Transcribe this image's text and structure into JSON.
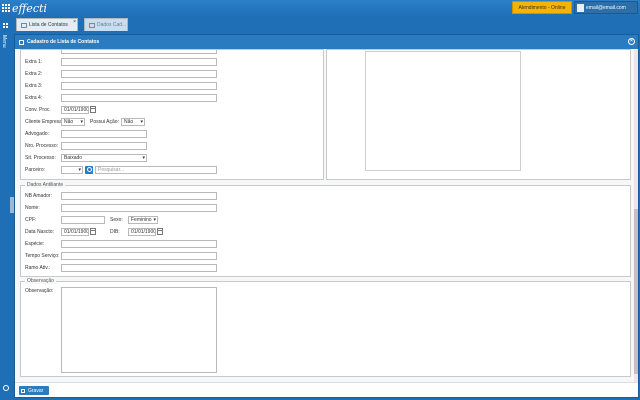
{
  "app": {
    "logo_text": "effecti"
  },
  "header": {
    "attendance_label": "Atendimento - Online",
    "user_email": "email@email.com"
  },
  "sidebar": {
    "menu_label": "Menu"
  },
  "tabs": [
    {
      "label": "Lista de Contatos"
    },
    {
      "label": "Dados Cad..."
    }
  ],
  "window": {
    "title": "Cadastro de Lista de Contatos"
  },
  "form": {
    "extra1_label": "Extra 1:",
    "extra2_label": "Extra 2:",
    "extra3_label": "Extra 3:",
    "extra4_label": "Extra 4:",
    "conv_proc_label": "Conv. Proc.",
    "conv_proc_value": "01/01/1900",
    "cliente_empresa_label": "Cliente Empresa:",
    "cliente_empresa_value": "Não",
    "possui_acao_label": "Possui Ação:",
    "possui_acao_value": "Não",
    "advogado_label": "Advogado:",
    "nro_processo_label": "Nro. Processo:",
    "sit_processo_label": "Sit. Processo:",
    "sit_processo_value": "Baixado",
    "parceiro_label": "Parceiro:",
    "parceiro_placeholder": "Pesquisar..."
  },
  "dados_antiliante": {
    "legend": "Dados Antiliante",
    "nb_amador_label": "NB Amador:",
    "nome_label": "Nome:",
    "cpf_label": "CPF:",
    "sexo_label": "Sexo:",
    "sexo_value": "Feminino",
    "data_nasc_label": "Data Nascto:",
    "data_nasc_value": "01/01/1900",
    "dib_label": "DIB:",
    "dib_value": "01/01/1900",
    "especie_label": "Espécie:",
    "tempo_servico_label": "Tempo Serviço:",
    "ramo_ativ_label": "Ramo Ativ.:"
  },
  "observacao": {
    "legend": "Observação",
    "label": "Observação:"
  },
  "footer": {
    "save_label": "Gravar"
  }
}
